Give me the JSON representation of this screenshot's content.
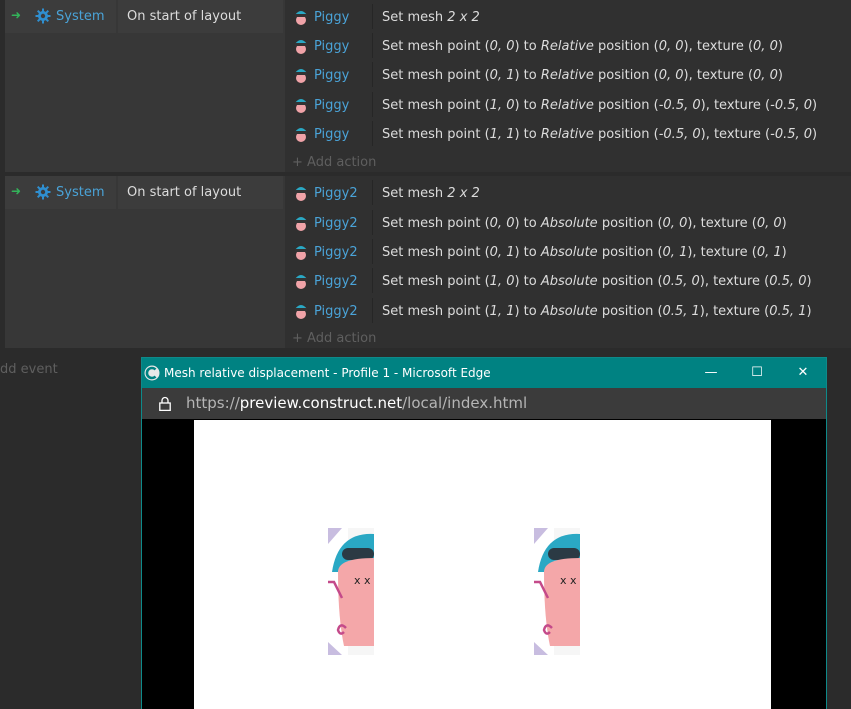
{
  "event_sheet": {
    "events": [
      {
        "condition": {
          "object": "System",
          "text": "On start of layout"
        },
        "actions": [
          {
            "object": "Piggy",
            "parts": [
              [
                "Set mesh ",
                false
              ],
              [
                "2 x 2",
                true
              ]
            ]
          },
          {
            "object": "Piggy",
            "parts": [
              [
                "Set mesh point (",
                false
              ],
              [
                "0, 0",
                true
              ],
              [
                ") to ",
                false
              ],
              [
                "Relative",
                true
              ],
              [
                " position (",
                false
              ],
              [
                "0, 0",
                true
              ],
              [
                "), texture (",
                false
              ],
              [
                "0, 0",
                true
              ],
              [
                ")",
                false
              ]
            ]
          },
          {
            "object": "Piggy",
            "parts": [
              [
                "Set mesh point (",
                false
              ],
              [
                "0, 1",
                true
              ],
              [
                ") to ",
                false
              ],
              [
                "Relative",
                true
              ],
              [
                " position (",
                false
              ],
              [
                "0, 0",
                true
              ],
              [
                "), texture (",
                false
              ],
              [
                "0, 0",
                true
              ],
              [
                ")",
                false
              ]
            ]
          },
          {
            "object": "Piggy",
            "parts": [
              [
                "Set mesh point (",
                false
              ],
              [
                "1, 0",
                true
              ],
              [
                ") to ",
                false
              ],
              [
                "Relative",
                true
              ],
              [
                " position (",
                false
              ],
              [
                "-0.5, 0",
                true
              ],
              [
                "), texture (",
                false
              ],
              [
                "-0.5, 0",
                true
              ],
              [
                ")",
                false
              ]
            ]
          },
          {
            "object": "Piggy",
            "parts": [
              [
                "Set mesh point (",
                false
              ],
              [
                "1, 1",
                true
              ],
              [
                ") to ",
                false
              ],
              [
                "Relative",
                true
              ],
              [
                " position (",
                false
              ],
              [
                "-0.5, 0",
                true
              ],
              [
                "), texture (",
                false
              ],
              [
                "-0.5, 0",
                true
              ],
              [
                ")",
                false
              ]
            ]
          }
        ],
        "add_action_label": "Add action"
      },
      {
        "condition": {
          "object": "System",
          "text": "On start of layout"
        },
        "actions": [
          {
            "object": "Piggy2",
            "parts": [
              [
                "Set mesh ",
                false
              ],
              [
                "2 x 2",
                true
              ]
            ]
          },
          {
            "object": "Piggy2",
            "parts": [
              [
                "Set mesh point (",
                false
              ],
              [
                "0, 0",
                true
              ],
              [
                ") to ",
                false
              ],
              [
                "Absolute",
                true
              ],
              [
                " position (",
                false
              ],
              [
                "0, 0",
                true
              ],
              [
                "), texture (",
                false
              ],
              [
                "0, 0",
                true
              ],
              [
                ")",
                false
              ]
            ]
          },
          {
            "object": "Piggy2",
            "parts": [
              [
                "Set mesh point (",
                false
              ],
              [
                "0, 1",
                true
              ],
              [
                ") to ",
                false
              ],
              [
                "Absolute",
                true
              ],
              [
                " position (",
                false
              ],
              [
                "0, 1",
                true
              ],
              [
                "), texture (",
                false
              ],
              [
                "0, 1",
                true
              ],
              [
                ")",
                false
              ]
            ]
          },
          {
            "object": "Piggy2",
            "parts": [
              [
                "Set mesh point (",
                false
              ],
              [
                "1, 0",
                true
              ],
              [
                ") to ",
                false
              ],
              [
                "Absolute",
                true
              ],
              [
                " position (",
                false
              ],
              [
                "0.5, 0",
                true
              ],
              [
                "), texture (",
                false
              ],
              [
                "0.5, 0",
                true
              ],
              [
                ")",
                false
              ]
            ]
          },
          {
            "object": "Piggy2",
            "parts": [
              [
                "Set mesh point (",
                false
              ],
              [
                "1, 1",
                true
              ],
              [
                ") to ",
                false
              ],
              [
                "Absolute",
                true
              ],
              [
                " position (",
                false
              ],
              [
                "0.5, 1",
                true
              ],
              [
                "), texture (",
                false
              ],
              [
                "0.5, 1",
                true
              ],
              [
                ")",
                false
              ]
            ]
          }
        ],
        "add_action_label": "Add action"
      }
    ],
    "add_event_label": "dd event"
  },
  "browser": {
    "title": "Mesh relative displacement - Profile 1 - Microsoft Edge",
    "url_scheme": "https://",
    "url_host": "preview.construct.net",
    "url_path": "/local/index.html",
    "controls": {
      "minimize": "—",
      "maximize": "☐",
      "close": "✕"
    }
  },
  "colors": {
    "object_link": "#4aa3d8",
    "titlebar": "#008282",
    "trigger_arrow": "#33b45a"
  },
  "icons": [
    "gear-icon",
    "piggy-icon",
    "edge-icon",
    "lock-icon",
    "trigger-arrow-icon",
    "plus-icon"
  ]
}
